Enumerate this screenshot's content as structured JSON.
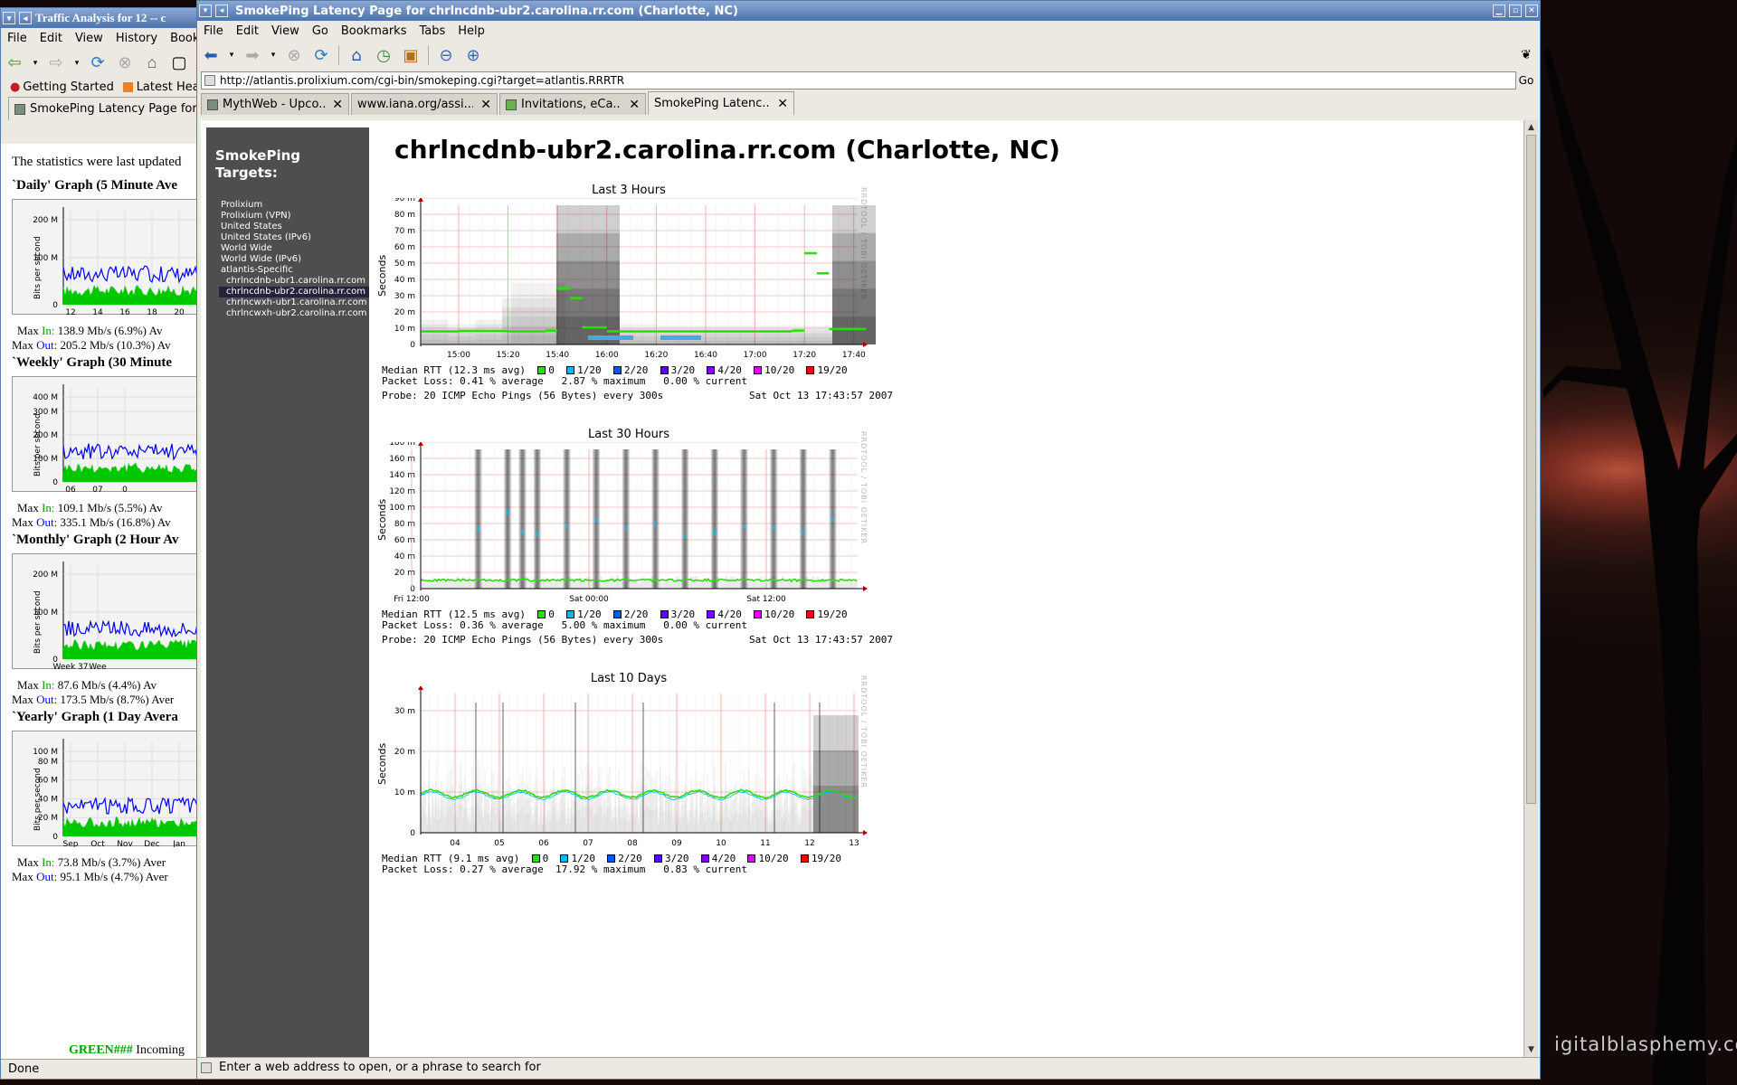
{
  "desktop": {
    "watermark": "igitalblasphemy.com"
  },
  "back_window": {
    "title": "Traffic Analysis for 12 -- c",
    "menus": [
      "File",
      "Edit",
      "View",
      "History",
      "Book"
    ],
    "bookmarks": [
      "Getting Started",
      "Latest Head"
    ],
    "tab_label": "SmokePing Latency Page for ch",
    "intro": "The statistics were last updated",
    "status": "Done",
    "sections": [
      {
        "heading": "`Daily' Graph (5 Minute Ave",
        "yticks": [
          "200 M",
          "100 M",
          "0"
        ],
        "xticks": [
          "12",
          "14",
          "16",
          "18",
          "20",
          "2"
        ],
        "ylabel": "Bits per second",
        "max_in_label": "Max",
        "in_word": "In:",
        "max_in": "138.9 Mb/s (6.9%)",
        "out_word": "Out:",
        "max_out": "205.2 Mb/s (10.3%)",
        "avg_in": "Av",
        "avg_out": "Av"
      },
      {
        "heading": "`Weekly' Graph (30 Minute",
        "yticks": [
          "400 M",
          "300 M",
          "200 M",
          "100 M",
          "0"
        ],
        "xticks": [
          "06",
          "07",
          "0"
        ],
        "ylabel": "Bits per second",
        "max_in_label": "Max",
        "in_word": "In:",
        "max_in": "109.1 Mb/s (5.5%)",
        "out_word": "Out:",
        "max_out": "335.1 Mb/s (16.8%)",
        "avg_in": "Av",
        "avg_out": "Av"
      },
      {
        "heading": "`Monthly' Graph (2 Hour Av",
        "yticks": [
          "200 M",
          "100 M",
          "0"
        ],
        "xticks": [
          "Week 37",
          "Wee"
        ],
        "ylabel": "Bits per second",
        "max_in_label": "Max",
        "in_word": "In:",
        "max_in": "87.6 Mb/s (4.4%)",
        "out_word": "Out:",
        "max_out": "173.5 Mb/s (8.7%)",
        "avg_in": "Av",
        "avg_out": "Aver"
      },
      {
        "heading": "`Yearly' Graph (1 Day Avera",
        "yticks": [
          "100 M",
          "80 M",
          "60 M",
          "40 M",
          "20 M",
          "0"
        ],
        "xticks": [
          "Sep",
          "Oct",
          "Nov",
          "Dec",
          "Jan"
        ],
        "ylabel": "Bits per second",
        "max_in_label": "Max",
        "in_word": "In:",
        "max_in": "73.8 Mb/s (3.7%)",
        "out_word": "Out:",
        "max_out": "95.1 Mb/s (4.7%)",
        "avg_in": "Aver",
        "avg_out": "Aver"
      }
    ],
    "footer_green": "GREEN###",
    "footer_text": "Incoming"
  },
  "window": {
    "title": "SmokePing Latency Page for chrlncdnb-ubr2.carolina.rr.com (Charlotte, NC)",
    "menus": [
      "File",
      "Edit",
      "View",
      "Go",
      "Bookmarks",
      "Tabs",
      "Help"
    ],
    "url": "http://atlantis.prolixium.com/cgi-bin/smokeping.cgi?target=atlantis.RRRTR",
    "go": "Go",
    "tabs": [
      "MythWeb - Upco...",
      "www.iana.org/assi...",
      "Invitations, eCa...",
      "SmokePing Latenc..."
    ],
    "status": "Enter a web address to open, or a phrase to search for"
  },
  "sidebar": {
    "title_line1": "SmokePing",
    "title_line2": "Targets:",
    "items": [
      "Prolixium",
      "Prolixium (VPN)",
      "United States",
      "United States (IPv6)",
      "World Wide",
      "World Wide (IPv6)",
      "atlantis-Specific"
    ],
    "subitems": [
      "chrlncdnb-ubr1.carolina.rr.com",
      "chrlncdnb-ubr2.carolina.rr.com",
      "chrlncwxh-ubr1.carolina.rr.com",
      "chrlncwxh-ubr2.carolina.rr.com"
    ],
    "selected_index": 1
  },
  "page": {
    "heading": "chrlncdnb-ubr2.carolina.rr.com (Charlotte, NC)"
  },
  "legend": {
    "colors": {
      "0": "#26e000",
      "1/20": "#00b8ff",
      "2/20": "#0059ff",
      "3/20": "#5e00ff",
      "4/20": "#7e00ff",
      "10/20": "#dd00ff",
      "19/20": "#ff0000"
    },
    "labels": [
      "0",
      "1/20",
      "2/20",
      "3/20",
      "4/20",
      "10/20",
      "19/20"
    ]
  },
  "chart_data": [
    {
      "type": "area",
      "title": "Last 3 Hours",
      "ylabel": "Seconds",
      "yticks": [
        "90 m",
        "80 m",
        "70 m",
        "60 m",
        "50 m",
        "40 m",
        "30 m",
        "20 m",
        "10 m",
        "0"
      ],
      "xticks": [
        "15:00",
        "15:20",
        "15:40",
        "16:00",
        "16:20",
        "16:40",
        "17:00",
        "17:20",
        "17:40"
      ],
      "ylim": [
        0,
        0.09
      ],
      "median_series": {
        "name": "Median RTT",
        "x": [
          "14:45",
          "15:00",
          "15:20",
          "15:35",
          "15:40",
          "15:45",
          "15:50",
          "16:00",
          "16:40",
          "17:00",
          "17:15",
          "17:20",
          "17:25",
          "17:30",
          "17:45"
        ],
        "y": [
          0.0085,
          0.0088,
          0.0085,
          0.009,
          0.036,
          0.03,
          0.011,
          0.0085,
          0.0085,
          0.0085,
          0.009,
          0.059,
          0.046,
          0.01,
          0.0088
        ]
      },
      "median_rtt": "Median RTT (12.3 ms avg)",
      "loss": "Packet Loss: 0.41 % average   2.87 % maximum   0.00 % current",
      "probe": "Probe: 20 ICMP Echo Pings (56 Bytes) every 300s",
      "timestamp": "Sat Oct 13 17:43:57 2007",
      "rrdtag": "RRDTOOL / TOBI OETIKER"
    },
    {
      "type": "area",
      "title": "Last 30 Hours",
      "ylabel": "Seconds",
      "yticks": [
        "180 m",
        "160 m",
        "140 m",
        "120 m",
        "100 m",
        "80 m",
        "60 m",
        "40 m",
        "20 m",
        "0"
      ],
      "xticks": [
        "Fri 12:00",
        "Sat 00:00",
        "Sat 12:00"
      ],
      "ylim": [
        0,
        0.19
      ],
      "spike_hours": [
        4.5,
        6.5,
        7.5,
        8.5,
        10.5,
        12.5,
        14.5,
        16.5,
        18.5,
        20.5,
        22.5,
        24.5,
        26.5,
        28.5
      ],
      "median_rtt": "Median RTT (12.5 ms avg)",
      "loss": "Packet Loss: 0.36 % average   5.00 % maximum   0.00 % current",
      "probe": "Probe: 20 ICMP Echo Pings (56 Bytes) every 300s",
      "timestamp": "Sat Oct 13 17:43:57 2007",
      "rrdtag": "RRDTOOL / TOBI OETIKER"
    },
    {
      "type": "area",
      "title": "Last 10 Days",
      "ylabel": "Seconds",
      "yticks": [
        "30 m",
        "20 m",
        "10 m",
        "0"
      ],
      "xticks": [
        "04",
        "05",
        "06",
        "07",
        "08",
        "09",
        "10",
        "11",
        "12",
        "13"
      ],
      "ylim": [
        0,
        0.035
      ],
      "median_rtt": "Median RTT (9.1 ms avg)",
      "loss": "Packet Loss: 0.27 % average  17.92 % maximum   0.83 % current",
      "rrdtag": "RRDTOOL / TOBI OETIKER"
    }
  ]
}
